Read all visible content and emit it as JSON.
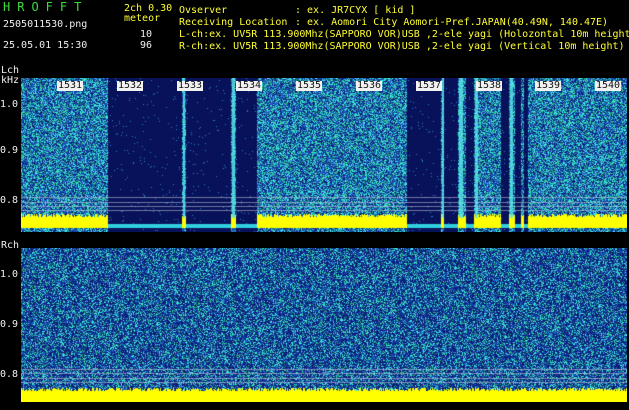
{
  "header": {
    "logo": "HROFFT",
    "mode": "2ch 0.30",
    "meteor_label": "meteor",
    "filename": "2505011530.png",
    "datetime": "25.05.01 15:30",
    "count_lch": "10",
    "count_rch": "96",
    "observer_label": "Ovserver",
    "observer_value": ": ex. JR7CYX [ kid ]",
    "location_label": "Receiving Location",
    "location_value": ": ex. Aomori City Aomori-Pref.JAPAN(40.49N, 140.47E)",
    "lch_info": "L-ch:ex. UV5R 113.900Mhz(SAPPORO VOR)USB ,2-ele yagi (Holozontal 10m height)",
    "rch_info": "R-ch:ex. UV5R 113.900Mhz(SAPPORO VOR)USB ,2-ele yagi (Vertical 10m height)"
  },
  "lch": {
    "label": "Lch",
    "unit": "kHz",
    "yticks": [
      "1.0",
      "0.9",
      "0.8"
    ]
  },
  "rch": {
    "label": "Rch",
    "yticks": [
      "1.0",
      "0.9",
      "0.8"
    ]
  },
  "time_markers": [
    "1531",
    "1532",
    "1533",
    "1534",
    "1535",
    "1536",
    "1537",
    "1538",
    "1539",
    "1540"
  ],
  "colors": {
    "background": "#000000",
    "header_green": "#3ddc3d",
    "header_yellow": "#ffff33",
    "signal_yellow": "#ffff00",
    "spectrum_dark": "#0a1a70",
    "spectrum_cyan": "#30e0e0"
  }
}
